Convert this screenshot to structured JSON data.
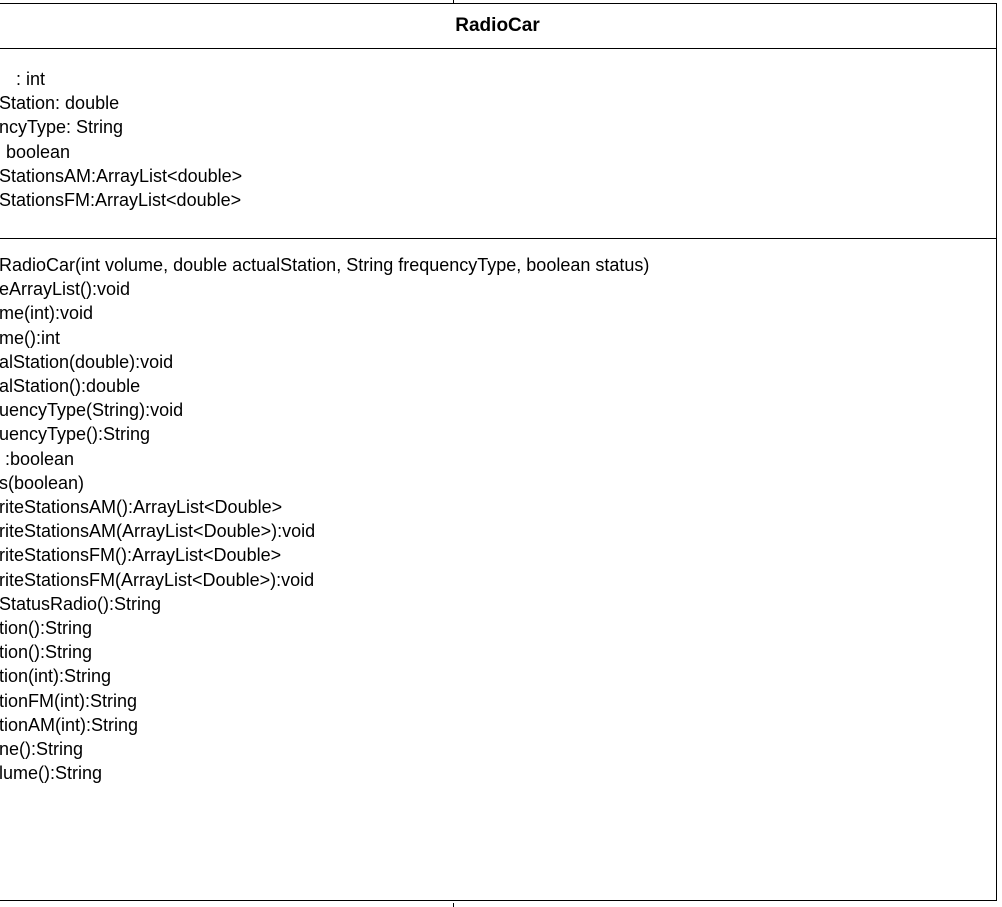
{
  "class": {
    "name": "RadioCar",
    "attributes": [
      ": int",
      "Station: double",
      "ncyType: String",
      "boolean",
      "StationsAM:ArrayList<double>",
      "StationsFM:ArrayList<double>"
    ],
    "methods": [
      "RadioCar(int volume, double actualStation, String frequencyType, boolean status)",
      "eArrayList():void",
      "me(int):void",
      "me():int",
      "alStation(double):void",
      "alStation():double",
      "uencyType(String):void",
      "uencyType():String",
      ":boolean",
      "s(boolean)",
      "riteStationsAM():ArrayList<Double>",
      "riteStationsAM(ArrayList<Double>):void",
      "riteStationsFM():ArrayList<Double>",
      "riteStationsFM(ArrayList<Double>):void",
      "StatusRadio():String",
      "tion():String",
      "tion():String",
      "tion(int):String",
      "tionFM(int):String",
      "tionAM(int):String",
      "ne():String",
      "lume():String"
    ]
  }
}
